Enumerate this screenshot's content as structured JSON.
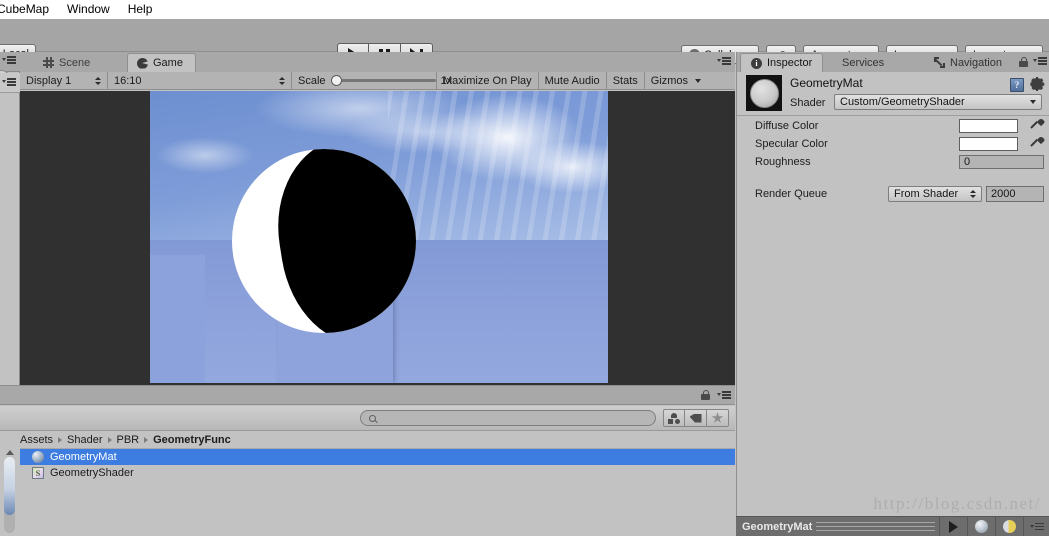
{
  "menubar": {
    "items": [
      "CubeMap",
      "Window",
      "Help"
    ]
  },
  "toolbar": {
    "local_button": "Local",
    "play_label": "Play",
    "pause_label": "Pause",
    "step_label": "Step",
    "collab": "Collab",
    "cloud_label": "Cloud",
    "account": "Account",
    "layers": "Layers",
    "layout": "Layout"
  },
  "game_panel": {
    "tabs": [
      {
        "label": "Scene",
        "icon": "scene-icon",
        "active": false
      },
      {
        "label": "Game",
        "icon": "game-icon",
        "active": true
      }
    ],
    "display": "Display 1",
    "aspect": "16:10",
    "scale_label": "Scale",
    "scale_value": "1x",
    "maximize_on_play": "Maximize On Play",
    "mute_audio": "Mute Audio",
    "stats": "Stats",
    "gizmos": "Gizmos"
  },
  "project_panel": {
    "search_placeholder": "",
    "search_value": "",
    "breadcrumb": [
      "Assets",
      "Shader",
      "PBR",
      "GeometryFunc"
    ],
    "assets": [
      {
        "name": "GeometryMat",
        "icon": "material-icon",
        "selected": true
      },
      {
        "name": "GeometryShader",
        "icon": "shader-icon",
        "selected": false
      }
    ],
    "filter_type_label": "Filter by Type",
    "filter_label_label": "Filter by Label",
    "favorites_label": "Favorites"
  },
  "inspector": {
    "tabs": [
      {
        "label": "Inspector",
        "icon": "info-icon",
        "active": true
      },
      {
        "label": "Services",
        "icon": "",
        "active": false
      },
      {
        "label": "Navigation",
        "icon": "navigation-icon",
        "active": false
      }
    ],
    "material_name": "GeometryMat",
    "shader_label": "Shader",
    "shader_value": "Custom/GeometryShader",
    "help_label": "?",
    "properties": [
      {
        "label": "Diffuse Color",
        "type": "color",
        "value": "#ffffff"
      },
      {
        "label": "Specular Color",
        "type": "color",
        "value": "#ffffff"
      },
      {
        "label": "Roughness",
        "type": "number",
        "value": "0"
      }
    ],
    "render_queue_label": "Render Queue",
    "render_queue_mode": "From Shader",
    "render_queue_value": "2000"
  },
  "preview_bar": {
    "title": "GeometryMat",
    "play_label": "Animate",
    "sphere_label": "Preview Mesh",
    "light_label": "Lighting"
  },
  "watermark": "http://blog.csdn.net/",
  "colors": {
    "toolbar_bg": "#a5a5a5",
    "panel_bg": "#c2c2c2",
    "tabstrip_bg": "#a8a8a8",
    "selection_blue": "#3d7ce0",
    "game_letterbox": "#303030",
    "preview_bar_bg": "#6d6d6d"
  }
}
